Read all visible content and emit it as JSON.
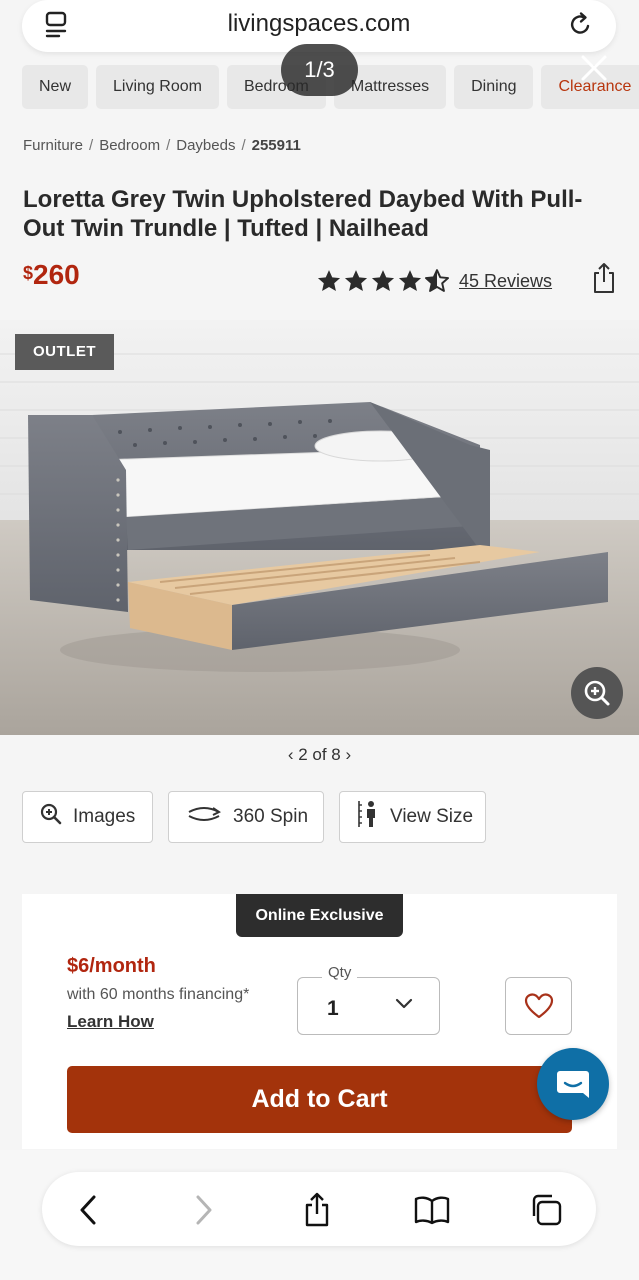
{
  "browser": {
    "domain": "livingspaces.com",
    "image_counter": "1/3"
  },
  "categories": [
    {
      "label": "New"
    },
    {
      "label": "Living Room"
    },
    {
      "label": "Bedroom"
    },
    {
      "label": "Mattresses"
    },
    {
      "label": "Dining"
    },
    {
      "label": "Clearance"
    }
  ],
  "breadcrumb": {
    "items": [
      "Furniture",
      "Bedroom",
      "Daybeds"
    ],
    "current": "255911",
    "separator": "/"
  },
  "product": {
    "title": "Loretta Grey Twin Upholstered Daybed With Pull-Out Twin Trundle | Tufted | Nailhead",
    "price_currency": "$",
    "price_amount": "260",
    "rating": 4.5,
    "reviews_label": "45 Reviews",
    "outlet_badge": "OUTLET"
  },
  "gallery": {
    "pager_text": "2 of 8",
    "buttons": {
      "images": "Images",
      "spin": "360 Spin",
      "view_size": "View Size"
    }
  },
  "purchase": {
    "online_badge": "Online Exclusive",
    "monthly": "$6/month",
    "financing": "with 60 months financing*",
    "learn_how": "Learn How",
    "qty_label": "Qty",
    "qty_value": "1",
    "add_to_cart": "Add to Cart"
  },
  "colors": {
    "accent_red": "#b1260f",
    "cart_button": "#a3330b",
    "chat_blue": "#0f6fa6",
    "badge_dark": "#2d2d2d"
  },
  "icons": {
    "toolbar": [
      "back-icon",
      "forward-icon",
      "share-icon",
      "bookmarks-icon",
      "tabs-icon"
    ]
  }
}
